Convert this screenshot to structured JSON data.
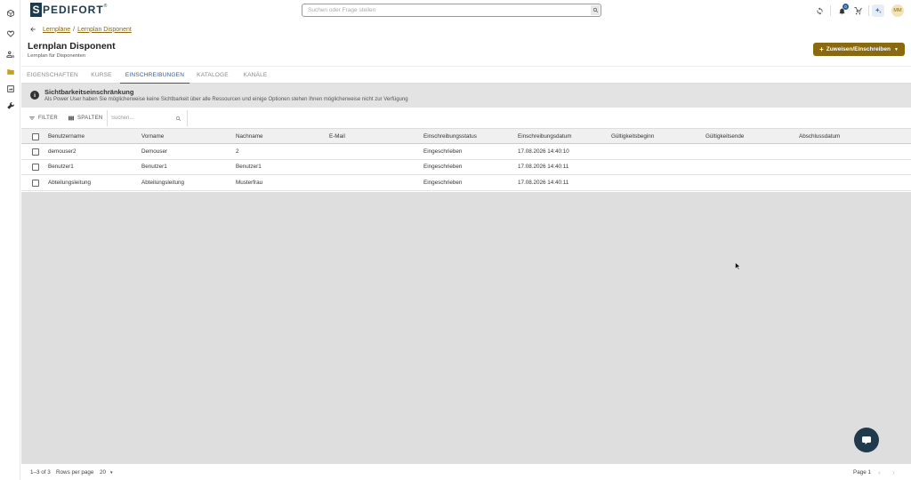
{
  "brand": {
    "mark": "S",
    "name": "PEDIFORT",
    "reg": "®"
  },
  "search": {
    "placeholder": "Suchen oder Frage stellen"
  },
  "top": {
    "notification_count": "0",
    "avatar_initials": "MM"
  },
  "breadcrumb": {
    "items": [
      "Lernpläne",
      "Lernplan Disponent"
    ],
    "separator": "/"
  },
  "page": {
    "title": "Lernplan Disponent",
    "subtitle": "Lernplan für Disponenten"
  },
  "cta": {
    "label": "Zuweisen/Einschreiben",
    "plus": "+",
    "caret": "▼"
  },
  "tabs": [
    {
      "label": "EIGENSCHAFTEN"
    },
    {
      "label": "KURSE"
    },
    {
      "label": "EINSCHREIBUNGEN",
      "active": true
    },
    {
      "label": "KATALOGE"
    },
    {
      "label": "KANÄLE"
    }
  ],
  "notice": {
    "icon": "i",
    "title": "Sichtbarkeitseinschränkung",
    "text": "Als Power User haben Sie möglicherweise keine Sichtbarkeit über alle Ressourcen und einige Optionen stehen Ihnen möglicherweise nicht zur Verfügung"
  },
  "toolbar": {
    "filter_label": "FILTER",
    "columns_label": "SPALTEN",
    "search_placeholder": "Suchen..."
  },
  "table": {
    "columns": [
      "Benutzername",
      "Vorname",
      "Nachname",
      "E-Mail",
      "Einschreibungsstatus",
      "Einschreibungsdatum",
      "Gültigkeitsbeginn",
      "Gültigkeitsende",
      "Abschlussdatum"
    ],
    "rows": [
      [
        "demouser2",
        "Demouser",
        "2",
        "",
        "Eingeschrieben",
        "17.08.2026 14:40:10",
        "",
        "",
        ""
      ],
      [
        "Benutzer1",
        "Benutzer1",
        "Benutzer1",
        "",
        "Eingeschrieben",
        "17.08.2026 14:40:11",
        "",
        "",
        ""
      ],
      [
        "Abteilungsleitung",
        "Abteilungsleitung",
        "Musterfrau",
        "",
        "Eingeschrieben",
        "17.08.2026 14:40:11",
        "",
        "",
        ""
      ]
    ]
  },
  "footer": {
    "range": "1–3 of 3",
    "rows_per_page_label": "Rows per page",
    "rows_per_page_value": "20",
    "caret": "▼",
    "page_label": "Page 1",
    "prev": "‹",
    "next": "›"
  },
  "colors": {
    "accent": "#8a6a10",
    "tab_active": "#2a5d9f",
    "brand": "#1e3a4c",
    "notice_bg": "#e3e3e3",
    "empty_area": "#dedede"
  }
}
